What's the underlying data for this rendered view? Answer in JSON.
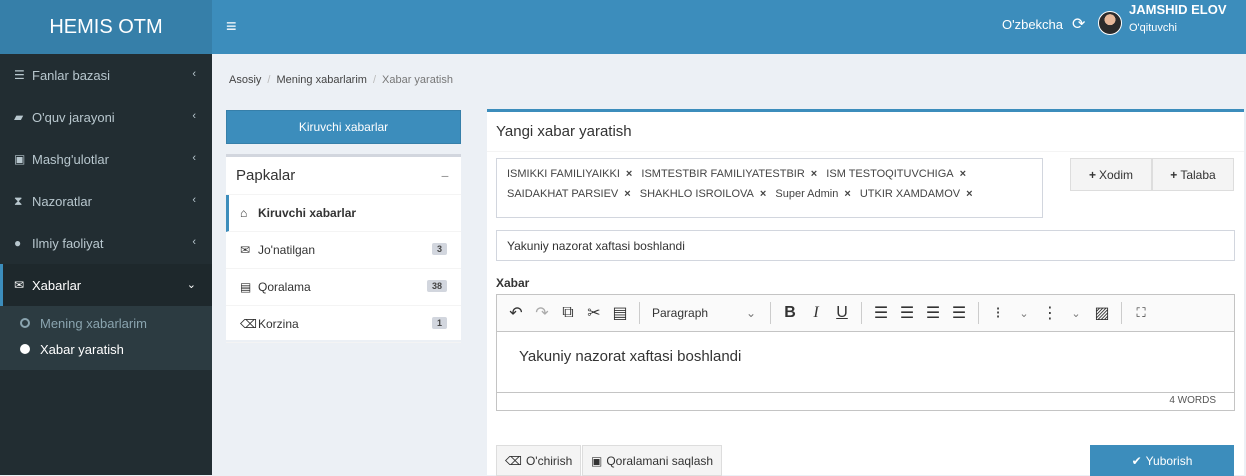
{
  "app": {
    "title": "HEMIS OTM"
  },
  "header": {
    "language": "O'zbekcha",
    "user_name": "JAMSHID ELOV",
    "user_role": "O'qituvchi"
  },
  "sidebar": {
    "items": [
      {
        "label": "Fanlar bazasi",
        "icon": "database-icon"
      },
      {
        "label": "O'quv jarayoni",
        "icon": "book-icon"
      },
      {
        "label": "Mashg'ulotlar",
        "icon": "calendar-icon"
      },
      {
        "label": "Nazoratlar",
        "icon": "hourglass-icon"
      },
      {
        "label": "Ilmiy faoliyat",
        "icon": "globe-icon"
      },
      {
        "label": "Xabarlar",
        "icon": "envelope-icon"
      }
    ],
    "submenu": [
      {
        "label": "Mening xabarlarim"
      },
      {
        "label": "Xabar yaratish"
      }
    ]
  },
  "breadcrumb": {
    "home": "Asosiy",
    "section": "Mening xabarlarim",
    "current": "Xabar yaratish"
  },
  "inbox_button": "Kiruvchi xabarlar",
  "folders": {
    "title": "Papkalar",
    "items": [
      {
        "label": "Kiruvchi xabarlar",
        "count": ""
      },
      {
        "label": "Jo'natilgan",
        "count": "3"
      },
      {
        "label": "Qoralama",
        "count": "38"
      },
      {
        "label": "Korzina",
        "count": "1"
      }
    ]
  },
  "compose": {
    "title": "Yangi xabar yaratish",
    "recipients": [
      "ISMIKKI FAMILIYAIKKI",
      "ISMTESTBIR FAMILIYATESTBIR",
      "ISM TESTOQITUVCHIGA",
      "SAIDAKHAT PARSIEV",
      "SHAKHLO ISROILOVA",
      "Super Admin",
      "UTKIR XAMDAMOV"
    ],
    "add_employee": "Xodim",
    "add_student": "Talaba",
    "subject": "Yakuniy nazorat xaftasi boshlandi",
    "body_label": "Xabar",
    "paragraph_select": "Paragraph",
    "body_text": "Yakuniy nazorat xaftasi boshlandi",
    "word_count": "4 WORDS",
    "delete_label": "O'chirish",
    "save_draft_label": "Qoralamani saqlash",
    "send_label": "Yuborish"
  }
}
